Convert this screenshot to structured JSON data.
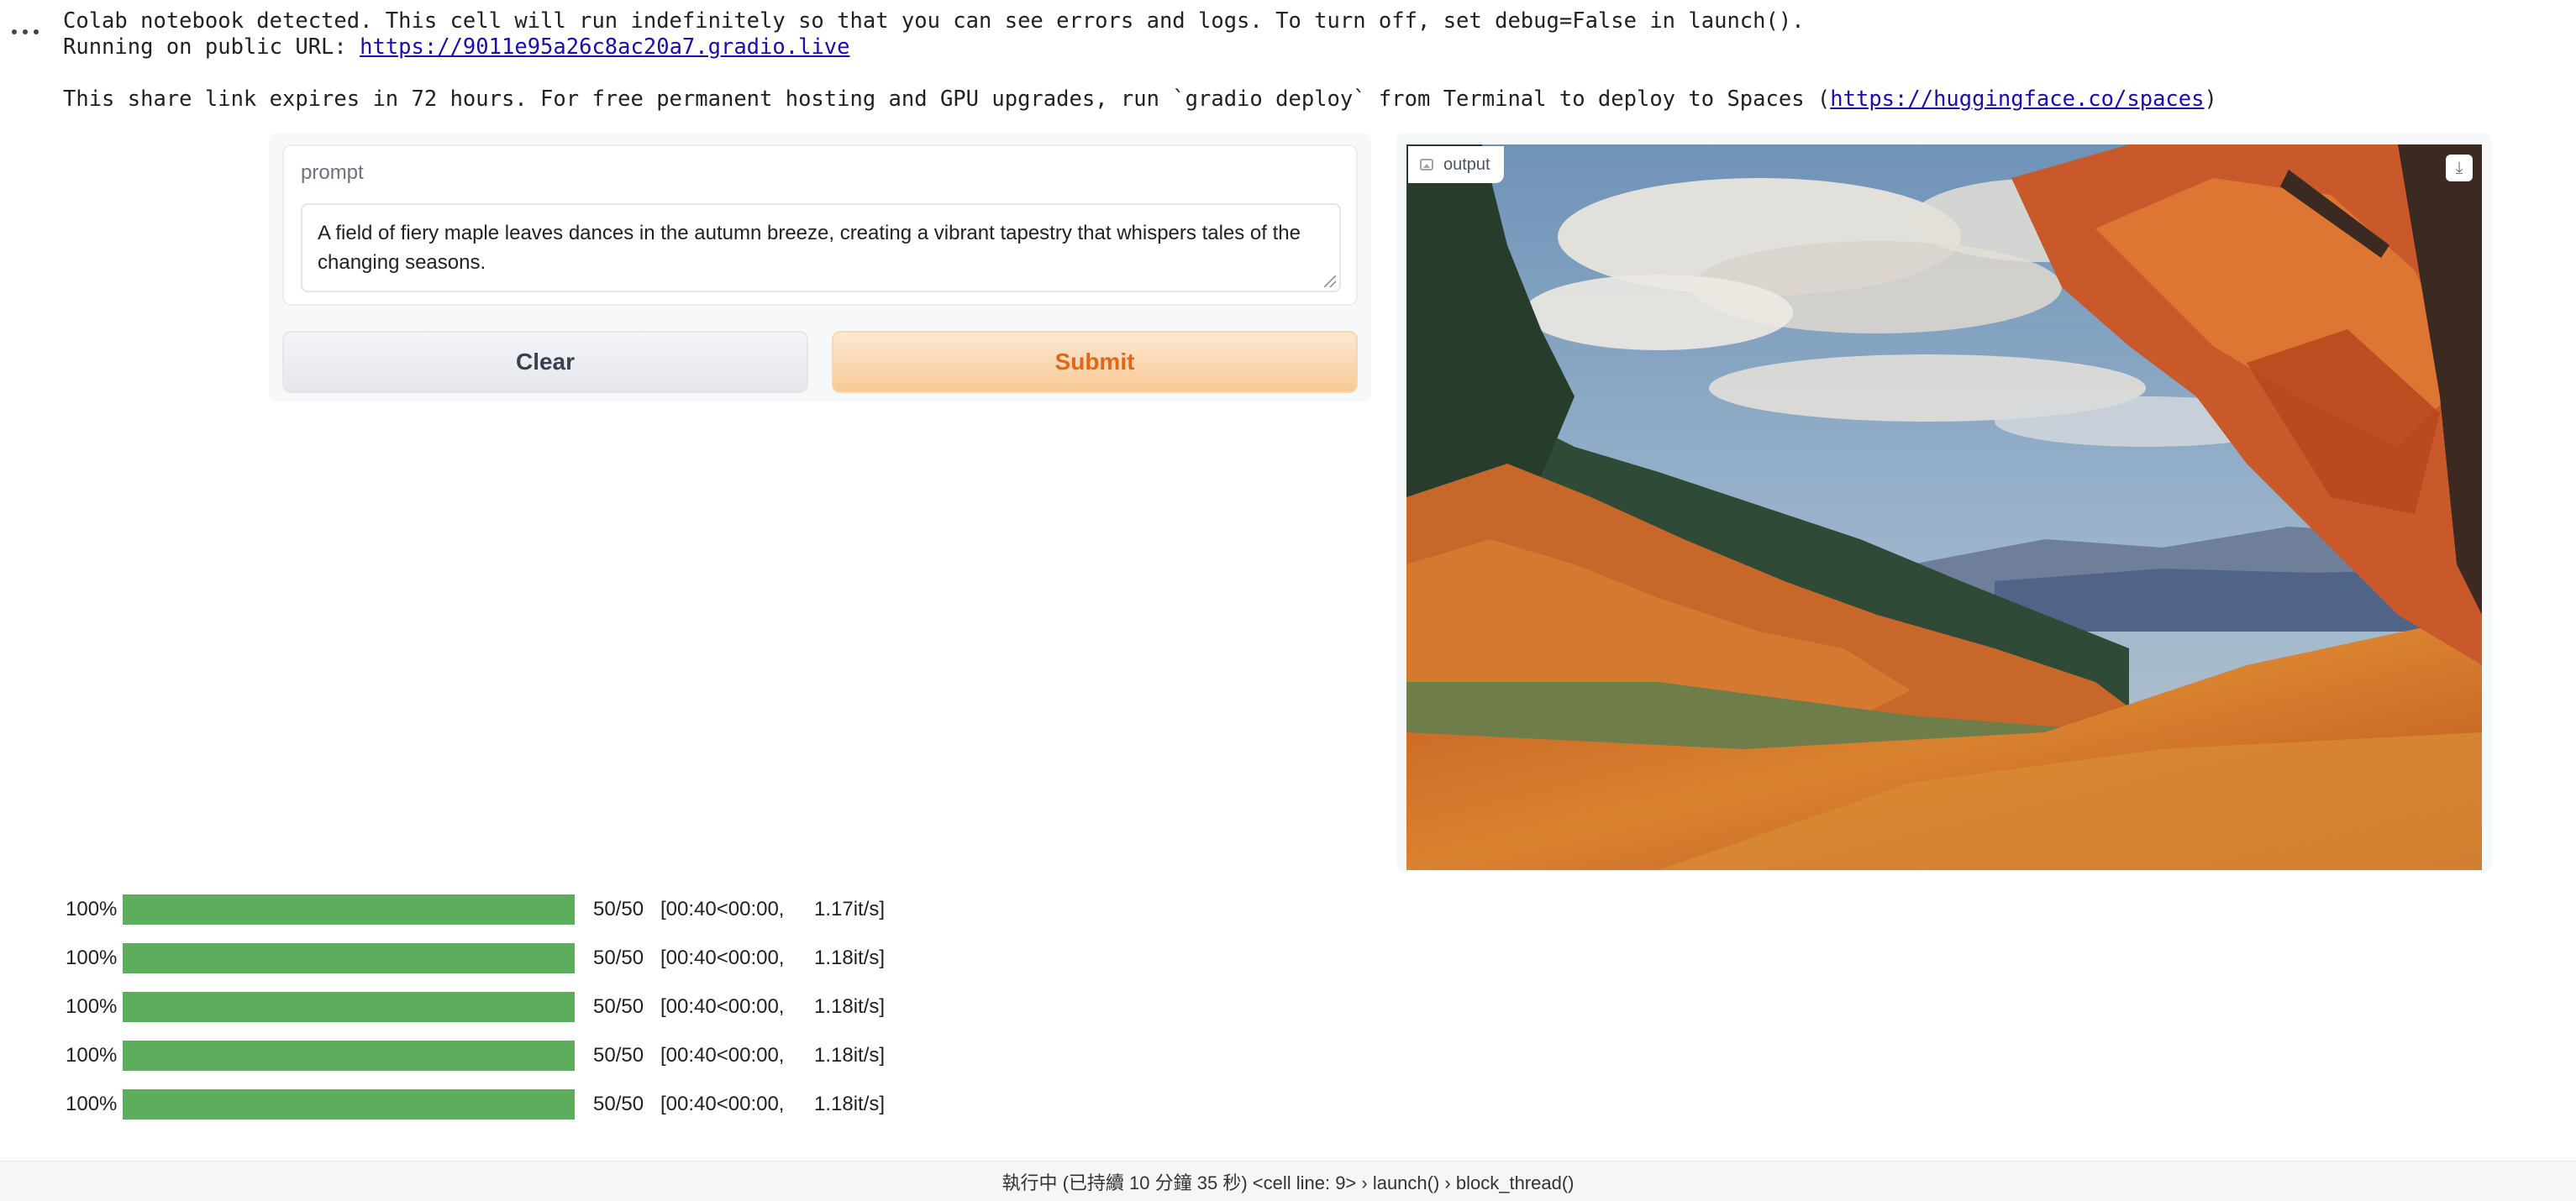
{
  "console": {
    "line1": "Colab notebook detected. This cell will run indefinitely so that you can see errors and logs. To turn off, set debug=False in launch().",
    "line2_prefix": "Running on public URL: ",
    "public_url": "https://9011e95a26c8ac20a7.gradio.live",
    "line3_prefix": "This share link expires in 72 hours. For free permanent hosting and GPU upgrades, run `gradio deploy` from Terminal to deploy to Spaces (",
    "spaces_url": "https://huggingface.co/spaces",
    "line3_suffix": ")"
  },
  "app": {
    "prompt_label": "prompt",
    "prompt_value": "A field of fiery maple leaves dances in the autumn breeze, creating a vibrant tapestry that whispers tales of the changing seasons.",
    "clear_label": "Clear",
    "submit_label": "Submit",
    "output_label": "output",
    "colors": {
      "submit_text": "#e0671a",
      "submit_bg": "#f8c996",
      "clear_bg": "#e5e7eb"
    }
  },
  "progress": [
    {
      "percent": "100%",
      "fraction": 1.0,
      "steps": "50/50",
      "timing": "[00:40<00:00,",
      "rate": "1.17it/s]"
    },
    {
      "percent": "100%",
      "fraction": 1.0,
      "steps": "50/50",
      "timing": "[00:40<00:00,",
      "rate": "1.18it/s]"
    },
    {
      "percent": "100%",
      "fraction": 1.0,
      "steps": "50/50",
      "timing": "[00:40<00:00,",
      "rate": "1.18it/s]"
    },
    {
      "percent": "100%",
      "fraction": 1.0,
      "steps": "50/50",
      "timing": "[00:40<00:00,",
      "rate": "1.18it/s]"
    },
    {
      "percent": "100%",
      "fraction": 1.0,
      "steps": "50/50",
      "timing": "[00:40<00:00,",
      "rate": "1.18it/s]"
    }
  ],
  "status_bar": {
    "text": "執行中 (已持續 10 分鐘 35 秒)  <cell line: 9> › launch() › block_thread()"
  },
  "icons": {
    "more": "more-horizontal-icon",
    "image": "image-icon",
    "download": "download-icon"
  }
}
